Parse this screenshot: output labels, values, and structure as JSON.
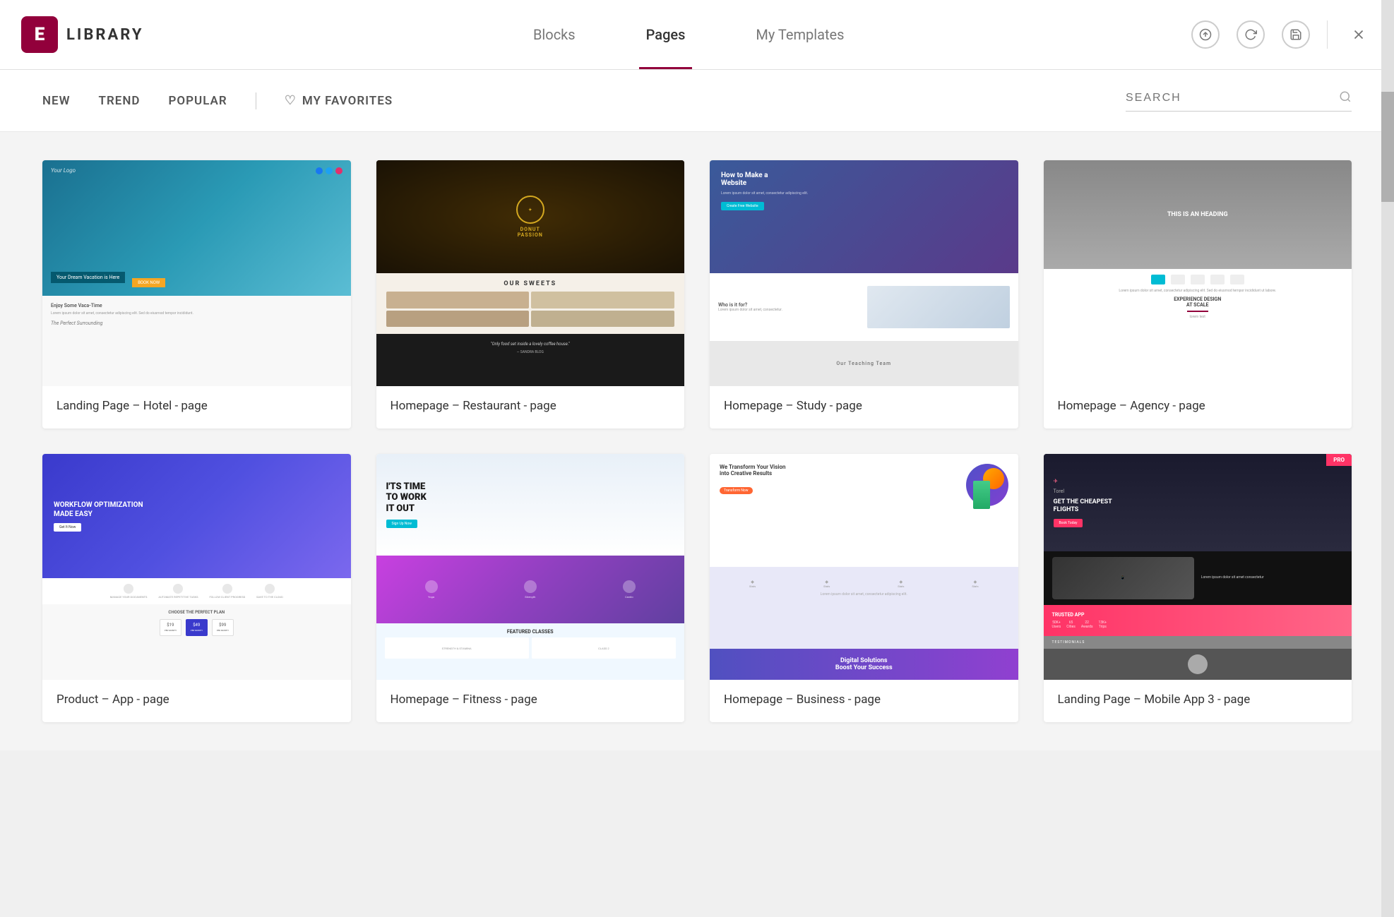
{
  "header": {
    "logo_letter": "E",
    "logo_text": "LIBRARY",
    "tabs": [
      {
        "id": "blocks",
        "label": "Blocks",
        "active": false
      },
      {
        "id": "pages",
        "label": "Pages",
        "active": true
      },
      {
        "id": "my-templates",
        "label": "My Templates",
        "active": false
      }
    ],
    "actions": {
      "upload_title": "upload",
      "refresh_title": "refresh",
      "save_title": "save",
      "close_title": "close"
    }
  },
  "filter_bar": {
    "items": [
      {
        "id": "new",
        "label": "NEW",
        "active": false
      },
      {
        "id": "trend",
        "label": "TREND",
        "active": false
      },
      {
        "id": "popular",
        "label": "POPULAR",
        "active": false
      }
    ],
    "favorites_label": "MY FAVORITES",
    "search_placeholder": "SEARCH"
  },
  "cards": [
    {
      "id": "hotel",
      "label": "Landing Page – Hotel - page",
      "thumb_type": "hotel"
    },
    {
      "id": "restaurant",
      "label": "Homepage – Restaurant - page",
      "thumb_type": "restaurant"
    },
    {
      "id": "study",
      "label": "Homepage – Study - page",
      "thumb_type": "study"
    },
    {
      "id": "agency",
      "label": "Homepage – Agency - page",
      "thumb_type": "agency"
    },
    {
      "id": "product",
      "label": "Product – App - page",
      "thumb_type": "product"
    },
    {
      "id": "fitness",
      "label": "Homepage – Fitness - page",
      "thumb_type": "fitness"
    },
    {
      "id": "business",
      "label": "Homepage – Business - page",
      "thumb_type": "business"
    },
    {
      "id": "mobile-app",
      "label": "Landing Page – Mobile App 3 - page",
      "thumb_type": "mobile",
      "badge": "PRO"
    }
  ]
}
